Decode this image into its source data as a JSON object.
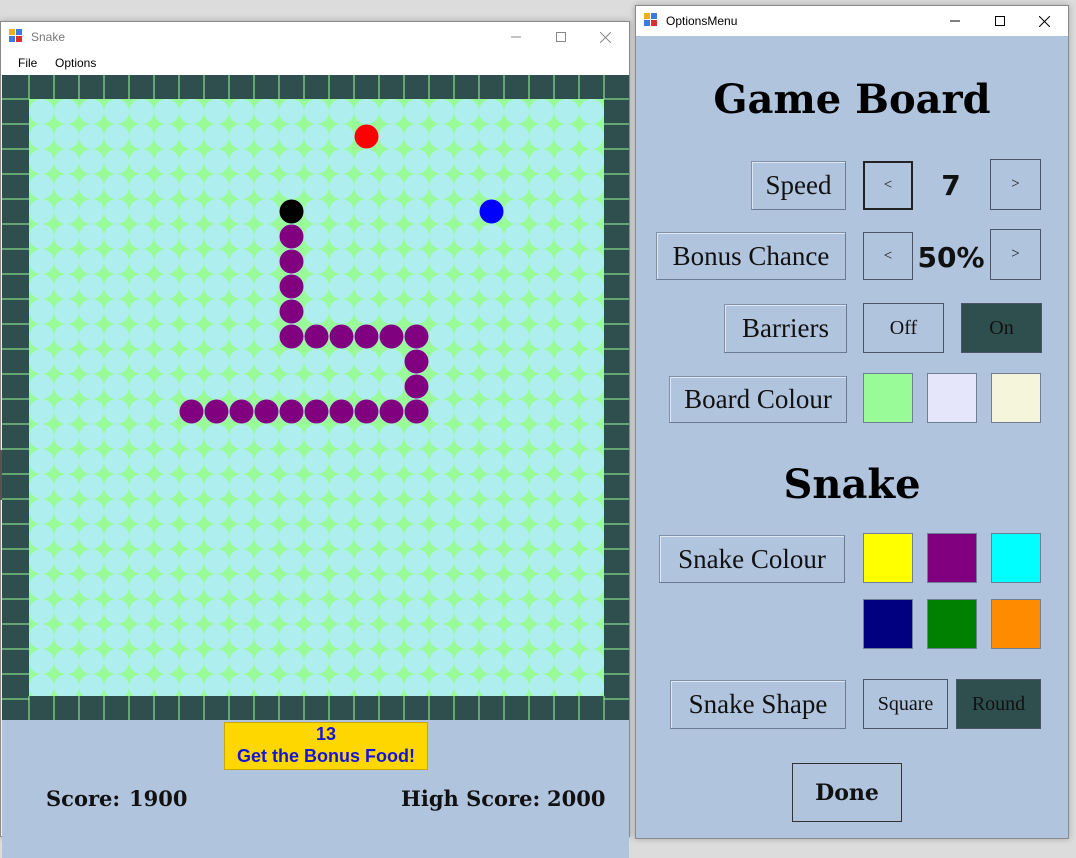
{
  "snake_window": {
    "title": "Snake",
    "menu": [
      "File",
      "Options"
    ],
    "bonus": {
      "countdown": "13",
      "message": "Get the Bonus Food!"
    },
    "score_label": "Score:",
    "score_value": "1900",
    "high_score_label": "High Score:",
    "high_score_value": "2000"
  },
  "options_window": {
    "title": "OptionsMenu",
    "game_board_heading": "Game Board",
    "speed": {
      "label": "Speed",
      "decrease": "<",
      "value": "7",
      "increase": ">"
    },
    "bonus_chance": {
      "label": "Bonus Chance",
      "decrease": "<",
      "value": "50%",
      "increase": ">"
    },
    "barriers": {
      "label": "Barriers",
      "off": "Off",
      "on": "On",
      "selected": "On"
    },
    "board_colour": {
      "label": "Board Colour",
      "options": [
        "#98fb98",
        "#e6e6fa",
        "#f5f5dc"
      ]
    },
    "snake_heading": "Snake",
    "snake_colour": {
      "label": "Snake Colour",
      "options": [
        "#ffff00",
        "#800080",
        "#00ffff",
        "#000080",
        "#008000",
        "#ff8c00"
      ]
    },
    "snake_shape": {
      "label": "Snake Shape",
      "square": "Square",
      "round": "Round",
      "selected": "Round"
    },
    "done": "Done"
  },
  "colors": {
    "board_border": "#2f4f4f",
    "board_fill": "#afeeee",
    "board_pattern": "#98fb98",
    "snake": "#800080",
    "snake_head": "#000000",
    "food": "#ff0000",
    "bonus_food": "#0000ff",
    "panel": "#b0c4de"
  }
}
